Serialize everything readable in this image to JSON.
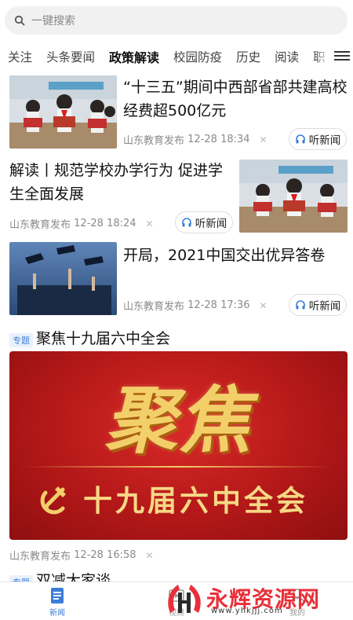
{
  "search": {
    "placeholder": "一键搜索"
  },
  "tabs": [
    {
      "label": "关注"
    },
    {
      "label": "头条要闻"
    },
    {
      "label": "政策解读",
      "active": true
    },
    {
      "label": "校园防疫"
    },
    {
      "label": "历史"
    },
    {
      "label": "阅读"
    },
    {
      "label": "职"
    }
  ],
  "articles": [
    {
      "title": "“十三五”期间中西部省部共建高校经费超500亿元",
      "source": "山东教育发布",
      "time": "12-28 18:34",
      "listen": "听新闻"
    },
    {
      "title": "解读丨规范学校办学行为 促进学生全面发展",
      "source": "山东教育发布",
      "time": "12-28 18:24",
      "listen": "听新闻"
    },
    {
      "title": "开局，2021中国交出优异答卷",
      "source": "山东教育发布",
      "time": "12-28 17:36",
      "listen": "听新闻"
    }
  ],
  "topic": {
    "label": "专题",
    "title": "聚焦十九届六中全会",
    "banner_big": "聚焦",
    "banner_sub": "十九届六中全会",
    "source": "山东教育发布",
    "time": "12-28 16:58"
  },
  "topic2": {
    "label": "专题",
    "title": "双减大家谈"
  },
  "bottom_nav": [
    {
      "label": "新闻",
      "active": true
    },
    {
      "label": "视频"
    },
    {
      "label": "我的"
    }
  ],
  "watermark": {
    "text": "永辉资源网",
    "url": "www.yhkjjj.com"
  },
  "colors": {
    "accent": "#3b7dd8",
    "banner_red": "#c21d1d",
    "banner_gold": "#f3cf6a"
  }
}
